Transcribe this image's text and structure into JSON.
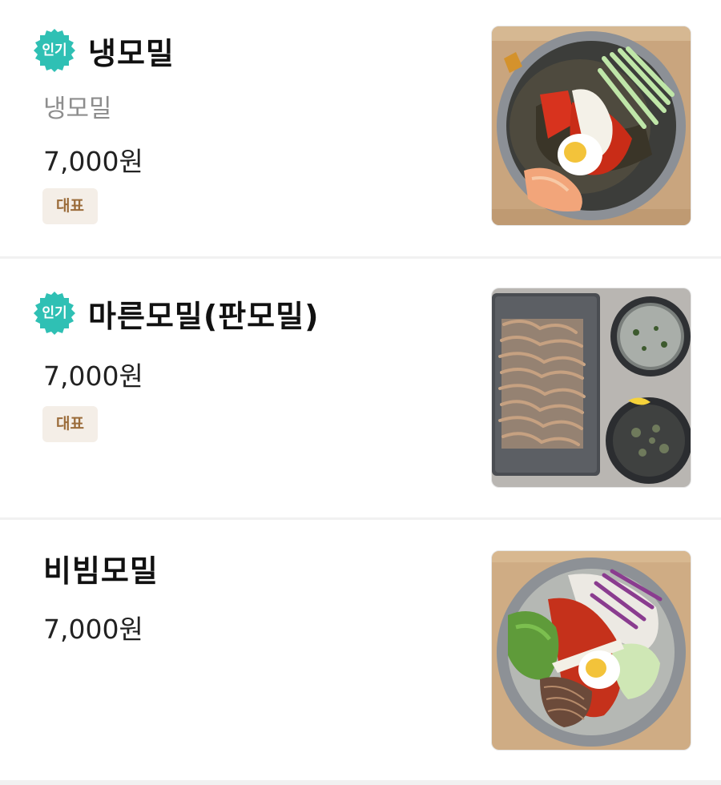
{
  "menu_items": [
    {
      "name": "냉모밀",
      "popular_badge": "인기",
      "description": "냉모밀",
      "price": "7,000원",
      "tag": "대표",
      "image_icon": "cold-buckwheat-noodle-bowl"
    },
    {
      "name": "마른모밀(판모밀)",
      "popular_badge": "인기",
      "price": "7,000원",
      "tag": "대표",
      "image_icon": "tray-buckwheat-noodles-with-dipping-broth"
    },
    {
      "name": "비빔모밀",
      "price": "7,000원",
      "image_icon": "spicy-mixed-buckwheat-noodle-bowl"
    }
  ],
  "colors": {
    "badge_teal": "#2fc0b4",
    "tag_background": "#f4eee7",
    "tag_text": "#9b6c3a",
    "price_text": "#222222",
    "description_text": "#8d8d8d"
  }
}
